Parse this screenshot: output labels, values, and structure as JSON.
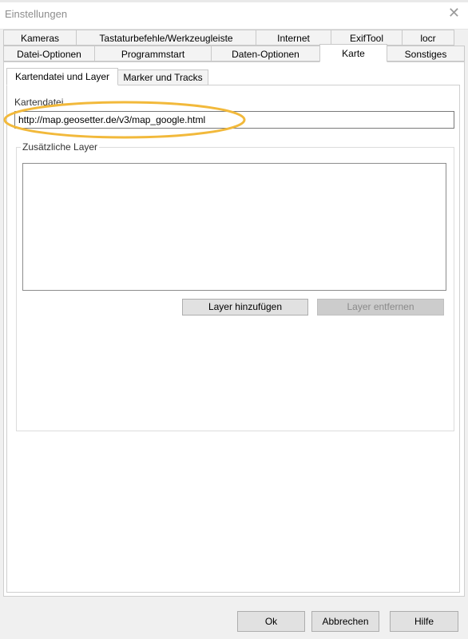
{
  "window": {
    "title": "Einstellungen"
  },
  "tabs_row1": [
    "Kameras",
    "Tastaturbefehle/Werkzeugleiste",
    "Internet",
    "ExifTool",
    "locr"
  ],
  "tabs_row2": [
    "Datei-Optionen",
    "Programmstart",
    "Daten-Optionen",
    "Karte",
    "Sonstiges"
  ],
  "active_tab": "Karte",
  "subtabs": [
    "Kartendatei und Layer",
    "Marker und Tracks"
  ],
  "active_subtab": "Kartendatei und Layer",
  "map_file": {
    "label": "Kartendatei",
    "value": "http://map.geosetter.de/v3/map_google.html"
  },
  "layers": {
    "label": "Zusätzliche Layer",
    "items": [],
    "add_button": "Layer hinzufügen",
    "remove_button": "Layer entfernen"
  },
  "footer": {
    "ok": "Ok",
    "cancel": "Abbrechen",
    "help": "Hilfe"
  },
  "colors": {
    "highlight": "#f2b93b"
  }
}
